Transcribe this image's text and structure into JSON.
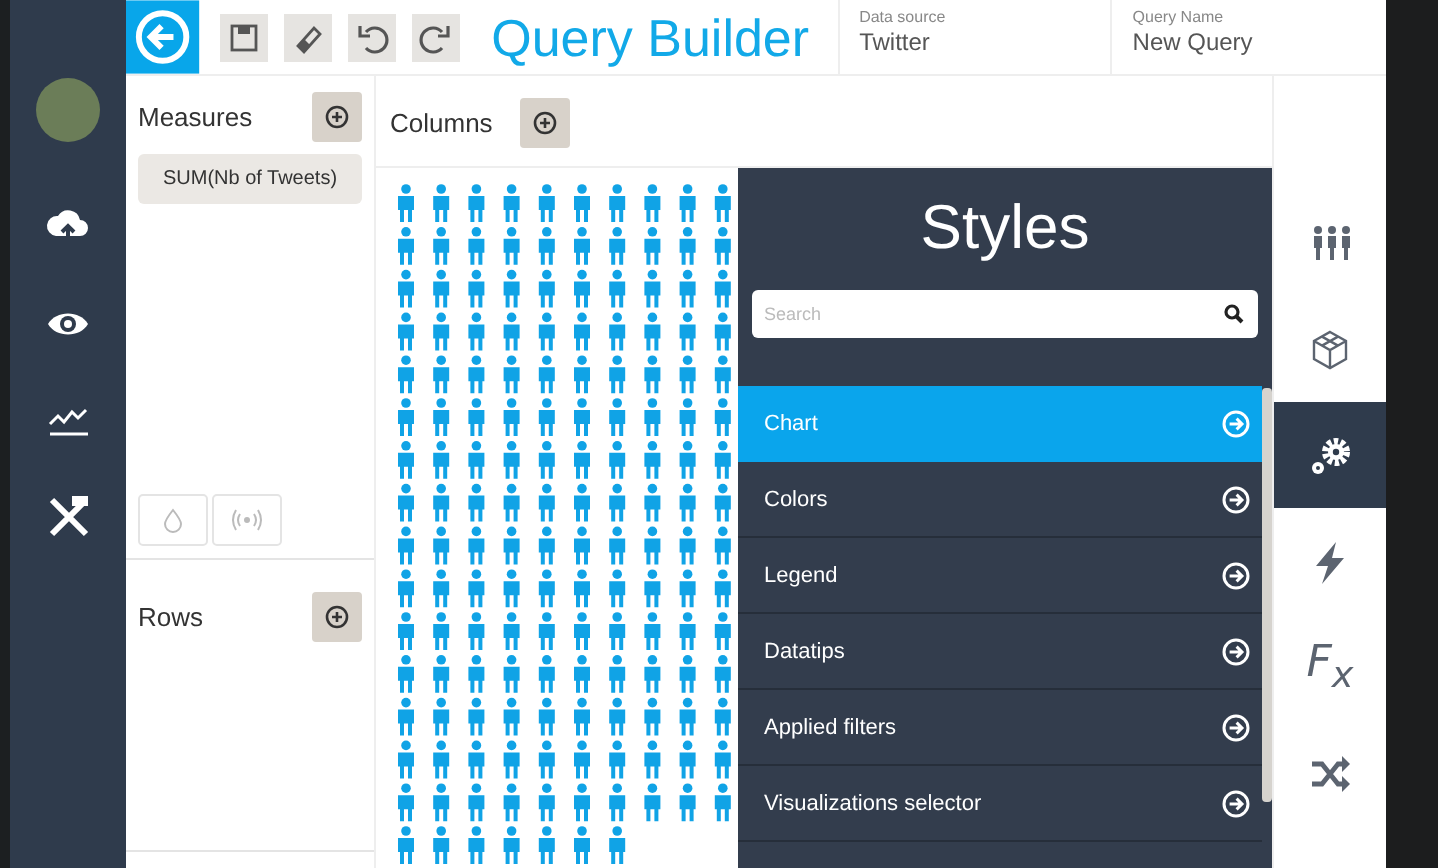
{
  "header": {
    "title": "Query Builder",
    "data_source": {
      "label": "Data source",
      "value": "Twitter"
    },
    "query_name": {
      "label": "Query Name",
      "value": "New Query"
    }
  },
  "sidebar": {
    "items": [
      {
        "kind": "upload"
      },
      {
        "kind": "eye"
      },
      {
        "kind": "trend"
      },
      {
        "kind": "tools"
      }
    ]
  },
  "measures": {
    "label": "Measures",
    "items": [
      "SUM(Nb of Tweets)"
    ]
  },
  "columns": {
    "label": "Columns"
  },
  "rows": {
    "label": "Rows"
  },
  "styles": {
    "title": "Styles",
    "search": {
      "placeholder": "Search"
    },
    "items": [
      {
        "label": "Chart",
        "selected": true
      },
      {
        "label": "Colors",
        "selected": false
      },
      {
        "label": "Legend",
        "selected": false
      },
      {
        "label": "Datatips",
        "selected": false
      },
      {
        "label": "Applied filters",
        "selected": false
      },
      {
        "label": "Visualizations selector",
        "selected": false
      }
    ]
  },
  "right_rail": {
    "items": [
      {
        "kind": "people",
        "selected": false
      },
      {
        "kind": "cube",
        "selected": false
      },
      {
        "kind": "gears",
        "selected": true
      },
      {
        "kind": "bolt",
        "selected": false
      },
      {
        "kind": "formula",
        "label": "F$_{x}$",
        "selected": false
      },
      {
        "kind": "shuffle",
        "selected": false
      }
    ]
  }
}
